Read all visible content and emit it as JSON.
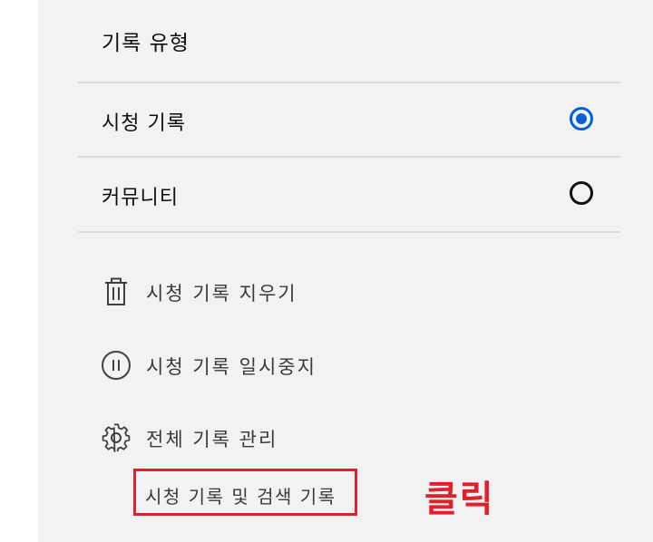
{
  "history_type": {
    "title": "기록 유형",
    "options": [
      {
        "label": "시청 기록",
        "selected": true
      },
      {
        "label": "커뮤니티",
        "selected": false
      }
    ]
  },
  "actions": [
    {
      "label": "시청 기록 지우기",
      "icon": "trash-icon"
    },
    {
      "label": "시청 기록 일시중지",
      "icon": "pause-circle-icon"
    },
    {
      "label": "전체 기록 관리",
      "icon": "gear-icon"
    }
  ],
  "sub_link": {
    "label": "시청 기록 및 검색 기록"
  },
  "annotation": {
    "text": "클릭"
  },
  "colors": {
    "accent": "#065fd4",
    "highlight": "#e0202a"
  }
}
